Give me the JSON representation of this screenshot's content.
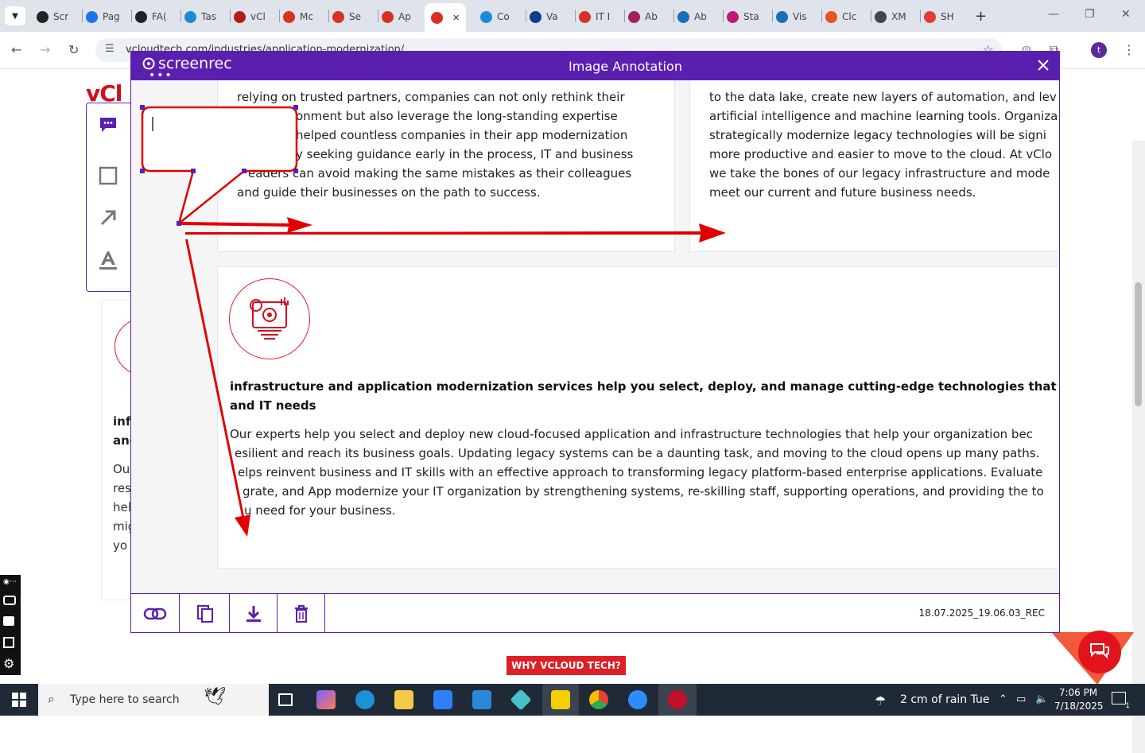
{
  "browser": {
    "tabs": [
      {
        "label": "Scr",
        "color": "#222222"
      },
      {
        "label": "Pag",
        "color": "#1a73e8"
      },
      {
        "label": "FA(",
        "color": "#222222"
      },
      {
        "label": "Tas",
        "color": "#1c8ad8"
      },
      {
        "label": "vCl",
        "color": "#b31b1b"
      },
      {
        "label": "Mc",
        "color": "#d93025"
      },
      {
        "label": "Se",
        "color": "#d93025"
      },
      {
        "label": "Ap",
        "color": "#d93025"
      },
      {
        "label": "",
        "color": "#d93025",
        "active": true
      },
      {
        "label": "Co",
        "color": "#1c8ad8"
      },
      {
        "label": "Va",
        "color": "#0b3d91"
      },
      {
        "label": "IT I",
        "color": "#d93025"
      },
      {
        "label": "Ab",
        "color": "#a0215f"
      },
      {
        "label": "Ab",
        "color": "#1c6db8"
      },
      {
        "label": "Sta",
        "color": "#c2187a"
      },
      {
        "label": "Vis",
        "color": "#1c6db8"
      },
      {
        "label": "Clc",
        "color": "#e5561e"
      },
      {
        "label": "XM",
        "color": "#444444"
      },
      {
        "label": "SH",
        "color": "#e53935"
      }
    ],
    "close_tab": "✕",
    "new_tab": "+",
    "url": "vcloudtech.com/industries/application-modernization/",
    "profile_initial": "t",
    "window_controls": [
      "—",
      "❐",
      "✕"
    ]
  },
  "page": {
    "logo_text": "vCl",
    "why_button": "WHY VCLOUD TECH?",
    "left_card": {
      "heading_lines": [
        "inf",
        "and"
      ],
      "body_lines": [
        "Ou",
        "res",
        "hel",
        "mig",
        "yo"
      ]
    }
  },
  "modal": {
    "app_name": "screenrec",
    "title": "Image Annotation",
    "close": "✕",
    "filename": "18.07.2025_19.06.03_REC",
    "card_top_left_lines": [
      "relying on trusted partners, companies can not only rethink their",
      "onment but also leverage the long-standing expertise",
      "helped countless companies in their app modernization",
      "y seeking guidance early in the process, IT and business",
      "eaders can avoid making the same mistakes as their colleagues",
      "and guide their businesses on the path to success."
    ],
    "card_top_right_lines": [
      "to the data lake, create new layers of automation, and lev",
      "artificial intelligence and machine learning tools. Organiza",
      "strategically modernize legacy technologies will be signi",
      "more productive and easier to move to the cloud. At vClo",
      "we take the bones of our legacy infrastructure and mode",
      "meet our current and future business needs."
    ],
    "card_bottom_heading_lines": [
      "infrastructure and application modernization services help you select, deploy, and manage cutting-edge technologies that support yo",
      "and IT needs"
    ],
    "card_bottom_body_lines": [
      "Our experts help you select and deploy new cloud-focused application and infrastructure technologies that help your organization bec",
      "esilient and reach its business goals. Updating legacy systems can be a daunting task, and moving to the cloud opens up many paths.",
      "elps reinvent business and IT skills with an effective approach to transforming legacy platform-based enterprise applications. Evaluate",
      "grate, and App modernize your IT organization by strengthening systems, re-skilling staff, supporting operations, and providing the to",
      "u need for your business."
    ]
  },
  "taskbar": {
    "search_placeholder": "Type here to search",
    "weather": "2 cm of rain Tue",
    "time": "7:06 PM",
    "date": "7/18/2025",
    "notification_count": "1"
  },
  "colors": {
    "screenrec_purple": "#5b1fb0",
    "annotation_red": "#e00000",
    "brand_red": "#d10f1f"
  }
}
